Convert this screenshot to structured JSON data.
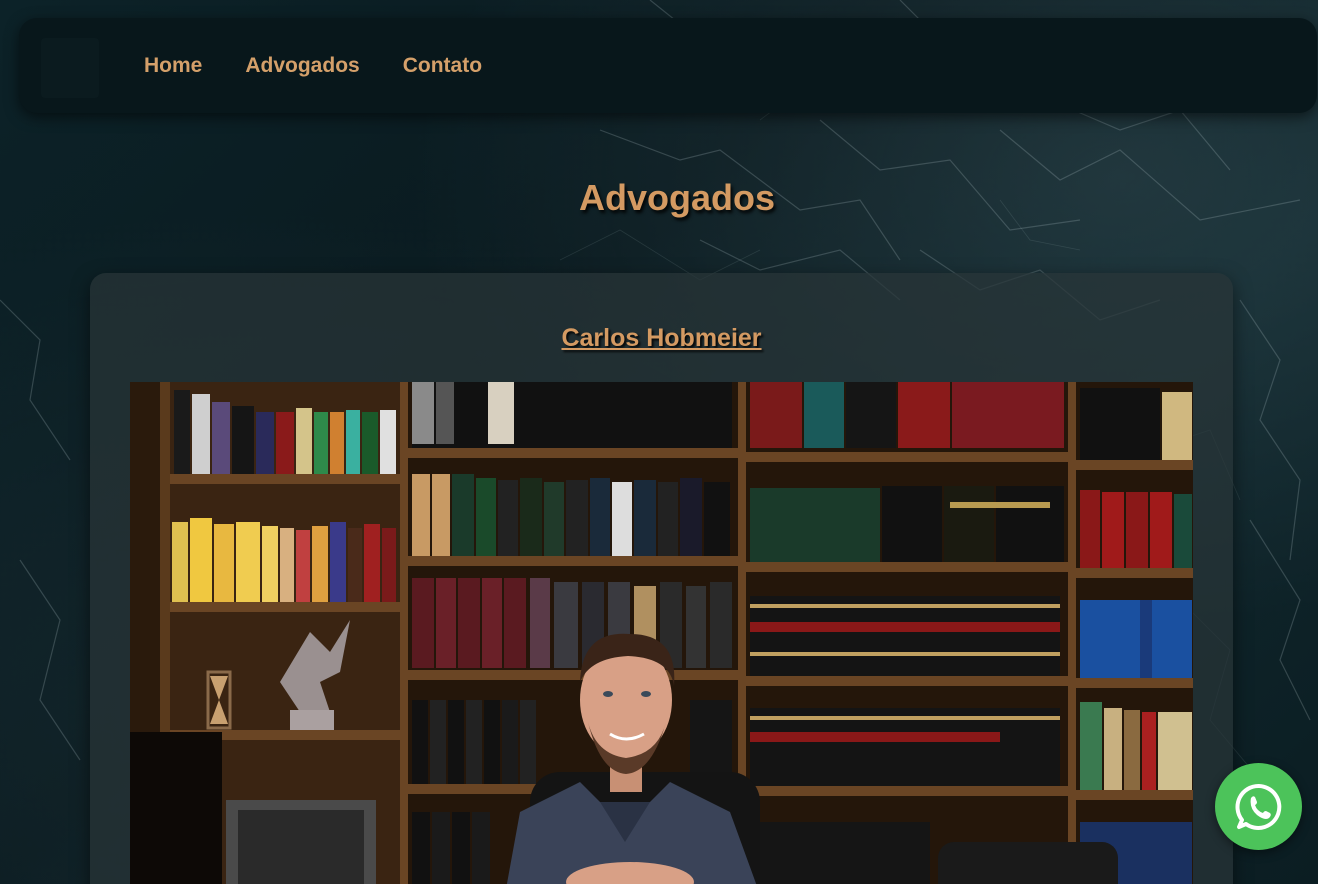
{
  "nav": {
    "logo_icon": "law-firm-logo-icon",
    "links": [
      {
        "label": "Home"
      },
      {
        "label": "Advogados"
      },
      {
        "label": "Contato"
      }
    ]
  },
  "main": {
    "title": "Advogados",
    "lawyers": [
      {
        "name": "Carlos Hobmeier",
        "photo_icon": "lawyer-portrait-photo"
      }
    ]
  },
  "floating": {
    "whatsapp_icon": "whatsapp-icon"
  },
  "colors": {
    "accent": "#d49a62",
    "navbar_bg": "#08171b",
    "page_bg": "#0c2228",
    "whatsapp": "#4cc35a"
  }
}
